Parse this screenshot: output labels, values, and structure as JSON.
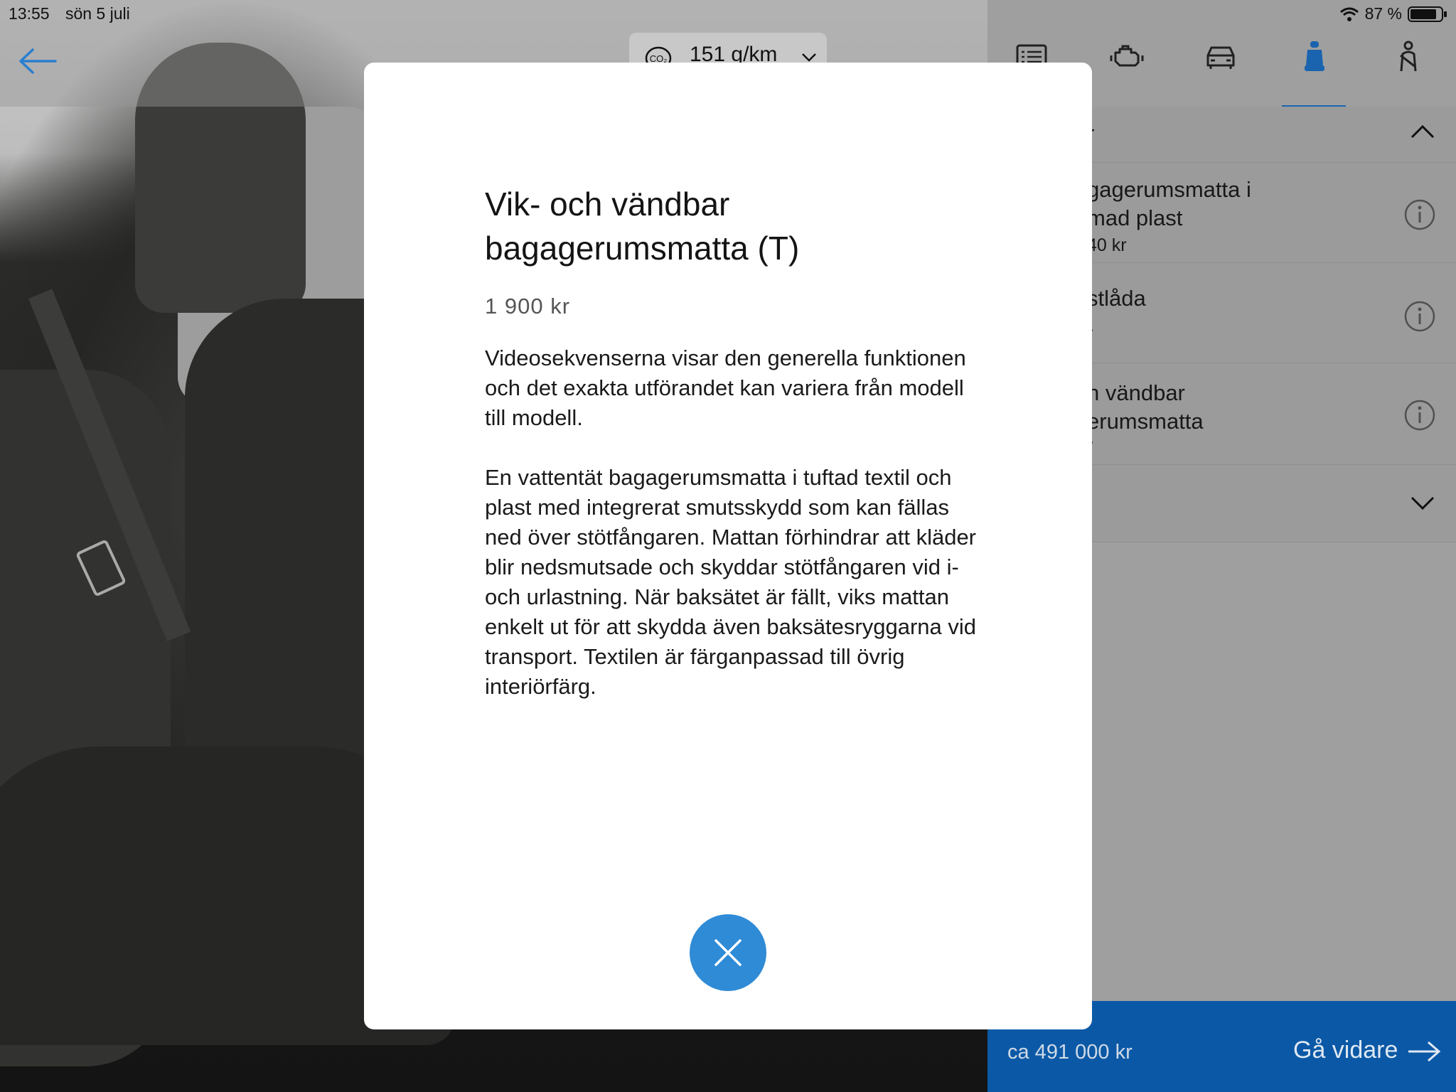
{
  "status_bar": {
    "time": "13:55",
    "date": "sön 5 juli",
    "battery": "87 %"
  },
  "header": {
    "co2_value": "151 g/km"
  },
  "right_panel": {
    "tabs": [
      {
        "icon": "list-icon"
      },
      {
        "icon": "engine-icon"
      },
      {
        "icon": "car-icon"
      },
      {
        "icon": "seat-icon",
        "active": true
      },
      {
        "icon": "seatbelt-person-icon"
      }
    ],
    "section_header": "r",
    "items": [
      {
        "title": "gagerumsmatta i\nmad plast",
        "price": "40 kr"
      },
      {
        "title": "stlåda",
        "price": "r"
      },
      {
        "title": "h vändbar\nerumsmatta",
        "price": "r"
      }
    ],
    "total": "ca 491 000 kr",
    "next_label": "Gå vidare"
  },
  "modal": {
    "title": "Vik- och vändbar bagagerumsmatta (T)",
    "price": "1 900 kr",
    "paragraph_1": "Videosekvenserna visar den generella funktionen och det exakta utförandet kan variera från modell till modell.",
    "paragraph_2": "En vattentät bagagerumsmatta i tuftad textil och plast med integrerat smutsskydd som kan fällas ned över stötfångaren. Mattan förhindrar att kläder blir nedsmutsade och skyddar stötfångaren vid i- och urlastning. När baksätet är fällt, viks mattan enkelt ut för att skydda även baksätesryggarna vid transport. Textilen är färganpassad till övrig interiörfärg."
  },
  "colors": {
    "accent": "#2f8bd6",
    "footer": "#0b59a6",
    "tab_active": "#1c6bba"
  }
}
